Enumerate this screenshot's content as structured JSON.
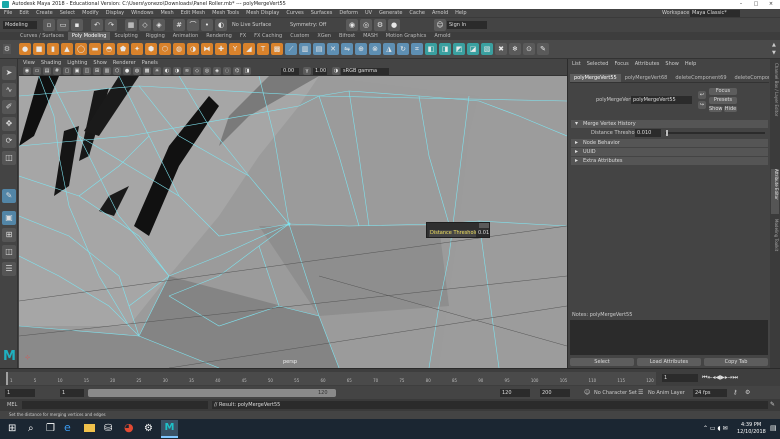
{
  "window": {
    "title": "Autodesk Maya 2018 - Educational Version: C:\\Users\\yonezo\\Downloads\\Panel Roller.mb* --- polyMergeVert55",
    "workspace_label": "Workspace:",
    "workspace_value": "Maya Classic*"
  },
  "menubar": {
    "items": [
      "File",
      "Edit",
      "Create",
      "Select",
      "Modify",
      "Display",
      "Windows",
      "Mesh",
      "Edit Mesh",
      "Mesh Tools",
      "Mesh Display",
      "Curves",
      "Surfaces",
      "Deform",
      "UV",
      "Generate",
      "Cache",
      "Arnold",
      "Help"
    ]
  },
  "statusline": {
    "mode": "Modeling",
    "live_surface": "No Live Surface",
    "symmetry": "Symmetry: Off",
    "signin": "Sign In"
  },
  "shelf_tabs": {
    "items": [
      "Curves / Surfaces",
      "Poly Modeling",
      "Sculpting",
      "Rigging",
      "Animation",
      "Rendering",
      "FX",
      "FX Caching",
      "Custom",
      "XGen",
      "Bifrost",
      "MASH",
      "Motion Graphics",
      "Arnold"
    ],
    "active": "Poly Modeling"
  },
  "viewport": {
    "menus": [
      "View",
      "Shading",
      "Lighting",
      "Show",
      "Renderer",
      "Panels"
    ],
    "exposure": "0.00",
    "gamma": "1.00",
    "color_space": "sRGB gamma",
    "hud_title": "Distance Threshold",
    "hud_value": "0.01",
    "persp_label": "persp"
  },
  "attr_editor": {
    "menus": [
      "List",
      "Selected",
      "Focus",
      "Attributes",
      "Show",
      "Help"
    ],
    "tabs": [
      "polyMergeVert55",
      "polyMergeVert68",
      "deleteComponent69",
      "deleteComponent"
    ],
    "node_label": "polyMergeVert:",
    "node_value": "polyMergeVert55",
    "buttons": {
      "focus": "Focus",
      "presets": "Presets",
      "show": "Show",
      "hide": "Hide"
    },
    "sections": [
      {
        "label": "Merge Vertex History",
        "open": true
      },
      {
        "label": "Node Behavior",
        "open": false
      },
      {
        "label": "UUID",
        "open": false
      },
      {
        "label": "Extra Attributes",
        "open": false
      }
    ],
    "distance_label": "Distance Threshold",
    "distance_value": "0.010",
    "notes_label": "Notes: polyMergeVert55",
    "bottom_buttons": [
      "Select",
      "Load Attributes",
      "Copy Tab"
    ]
  },
  "side_tabs": [
    "Channel Box / Layer Editor",
    "Attribute Editor",
    "Modeling Toolkit"
  ],
  "timeslider": {
    "ticks": [
      "1",
      "5",
      "10",
      "15",
      "20",
      "25",
      "30",
      "35",
      "40",
      "45",
      "50",
      "55",
      "60",
      "65",
      "70",
      "75",
      "80",
      "85",
      "90",
      "95",
      "100",
      "105",
      "110",
      "115",
      "120"
    ],
    "current_frame": "1"
  },
  "rangeslider": {
    "start": "1",
    "start_inner": "1",
    "end_inner": "120",
    "end": "120",
    "max": "200",
    "char_set": "No Character Set",
    "anim_layer": "No Anim Layer",
    "fps": "24 fps"
  },
  "cmdline": {
    "lang": "MEL",
    "result": "// Result: polyMergeVert55"
  },
  "helpline": {
    "text": "Set the distance for merging vertices and edges"
  },
  "taskbar": {
    "time": "4:39 PM",
    "date": "12/10/2018"
  },
  "colors": {
    "accent": "#5285a6",
    "wire": "#7fe3ef",
    "hud_text": "#f0e060",
    "shelf_active": "#5d5d5d"
  }
}
